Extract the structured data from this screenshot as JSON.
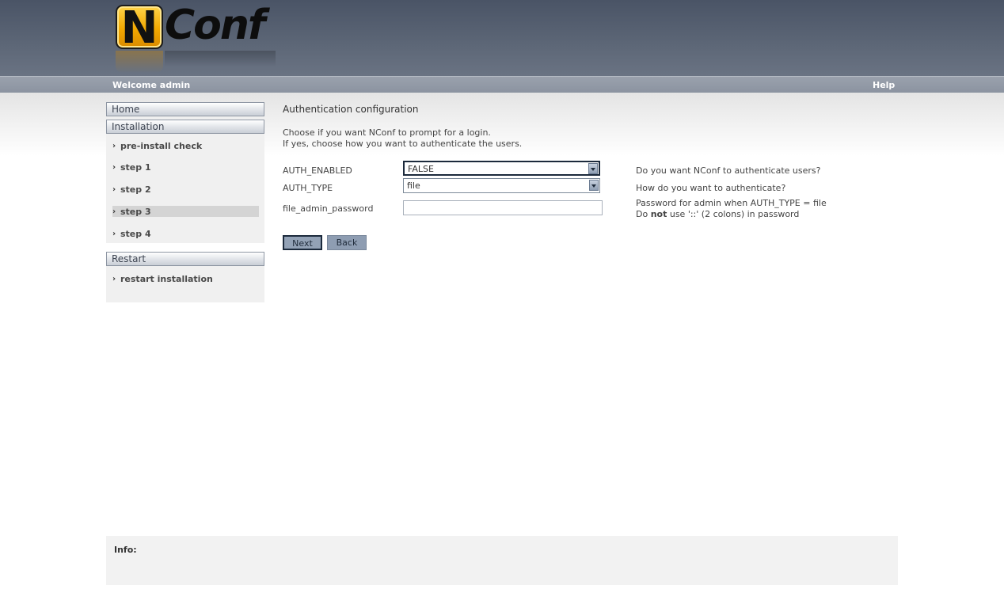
{
  "header": {
    "logo_text": "NConf",
    "welcome": "Welcome admin",
    "help": "Help"
  },
  "sidebar": {
    "home": "Home",
    "installation": "Installation",
    "install_items": [
      {
        "label": "pre-install check"
      },
      {
        "label": "step 1"
      },
      {
        "label": "step 2"
      },
      {
        "label": "step 3",
        "active": true
      },
      {
        "label": "step 4"
      }
    ],
    "restart": "Restart",
    "restart_items": [
      {
        "label": "restart installation"
      }
    ]
  },
  "main": {
    "title": "Authentication configuration",
    "intro_line1": "Choose if you want NConf to prompt for a login.",
    "intro_line2": "If yes, choose how you want to authenticate the users.",
    "fields": [
      {
        "label": "AUTH_ENABLED",
        "value": "FALSE",
        "desc1": "Do you want NConf to authenticate users?"
      },
      {
        "label": "AUTH_TYPE",
        "value": "file",
        "desc1": "How do you want to authenticate?"
      },
      {
        "label": "file_admin_password",
        "value": "",
        "desc1": "Password for admin when AUTH_TYPE = file",
        "desc2_pre": "Do ",
        "desc2_bold": "not",
        "desc2_post": " use '::' (2 colons) in password"
      }
    ],
    "next": "Next",
    "back": "Back"
  },
  "info": {
    "label": "Info:"
  },
  "colors": {
    "header_top": "#4a5466",
    "navbar": "#8b93a0",
    "button": "#8e9db2",
    "logo_orange": "#f2a800"
  }
}
